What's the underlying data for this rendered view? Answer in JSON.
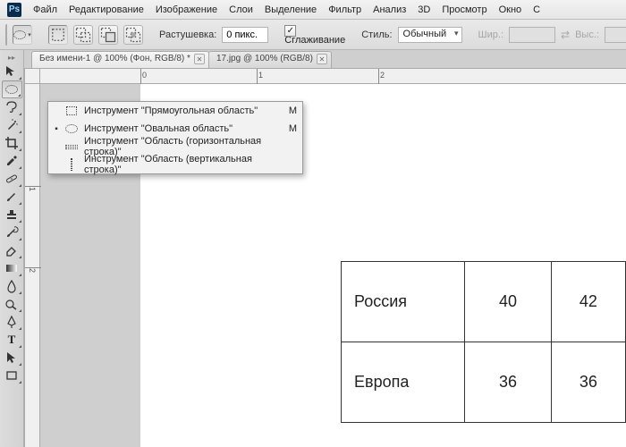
{
  "menu": {
    "items": [
      "Файл",
      "Редактирование",
      "Изображение",
      "Слои",
      "Выделение",
      "Фильтр",
      "Анализ",
      "3D",
      "Просмотр",
      "Окно",
      "С"
    ]
  },
  "options": {
    "feather_label": "Растушевка:",
    "feather_value": "0 пикс.",
    "antialias_label": "Сглаживание",
    "style_label": "Стиль:",
    "style_value": "Обычный",
    "width_label": "Шир.:",
    "height_label": "Выс.:"
  },
  "tabs": [
    {
      "label": "Без имени-1 @ 100% (Фон, RGB/8) *",
      "active": true
    },
    {
      "label": "17.jpg @ 100% (RGB/8)",
      "active": false
    }
  ],
  "ruler": {
    "h0": "0",
    "h1": "1",
    "h2": "2",
    "v1": "1",
    "v2": "2"
  },
  "flyout": {
    "items": [
      {
        "label": "Инструмент \"Прямоугольная область\"",
        "shortcut": "M",
        "selected": false,
        "icon": "rect"
      },
      {
        "label": "Инструмент \"Овальная область\"",
        "shortcut": "M",
        "selected": true,
        "icon": "ellipse"
      },
      {
        "label": "Инструмент \"Область (горизонтальная строка)\"",
        "shortcut": "",
        "selected": false,
        "icon": "row"
      },
      {
        "label": "Инструмент \"Область (вертикальная строка)\"",
        "shortcut": "",
        "selected": false,
        "icon": "col"
      }
    ]
  },
  "table": {
    "rows": [
      {
        "name": "Россия",
        "a": "40",
        "b": "42"
      },
      {
        "name": "Европа",
        "a": "36",
        "b": "36"
      }
    ]
  }
}
